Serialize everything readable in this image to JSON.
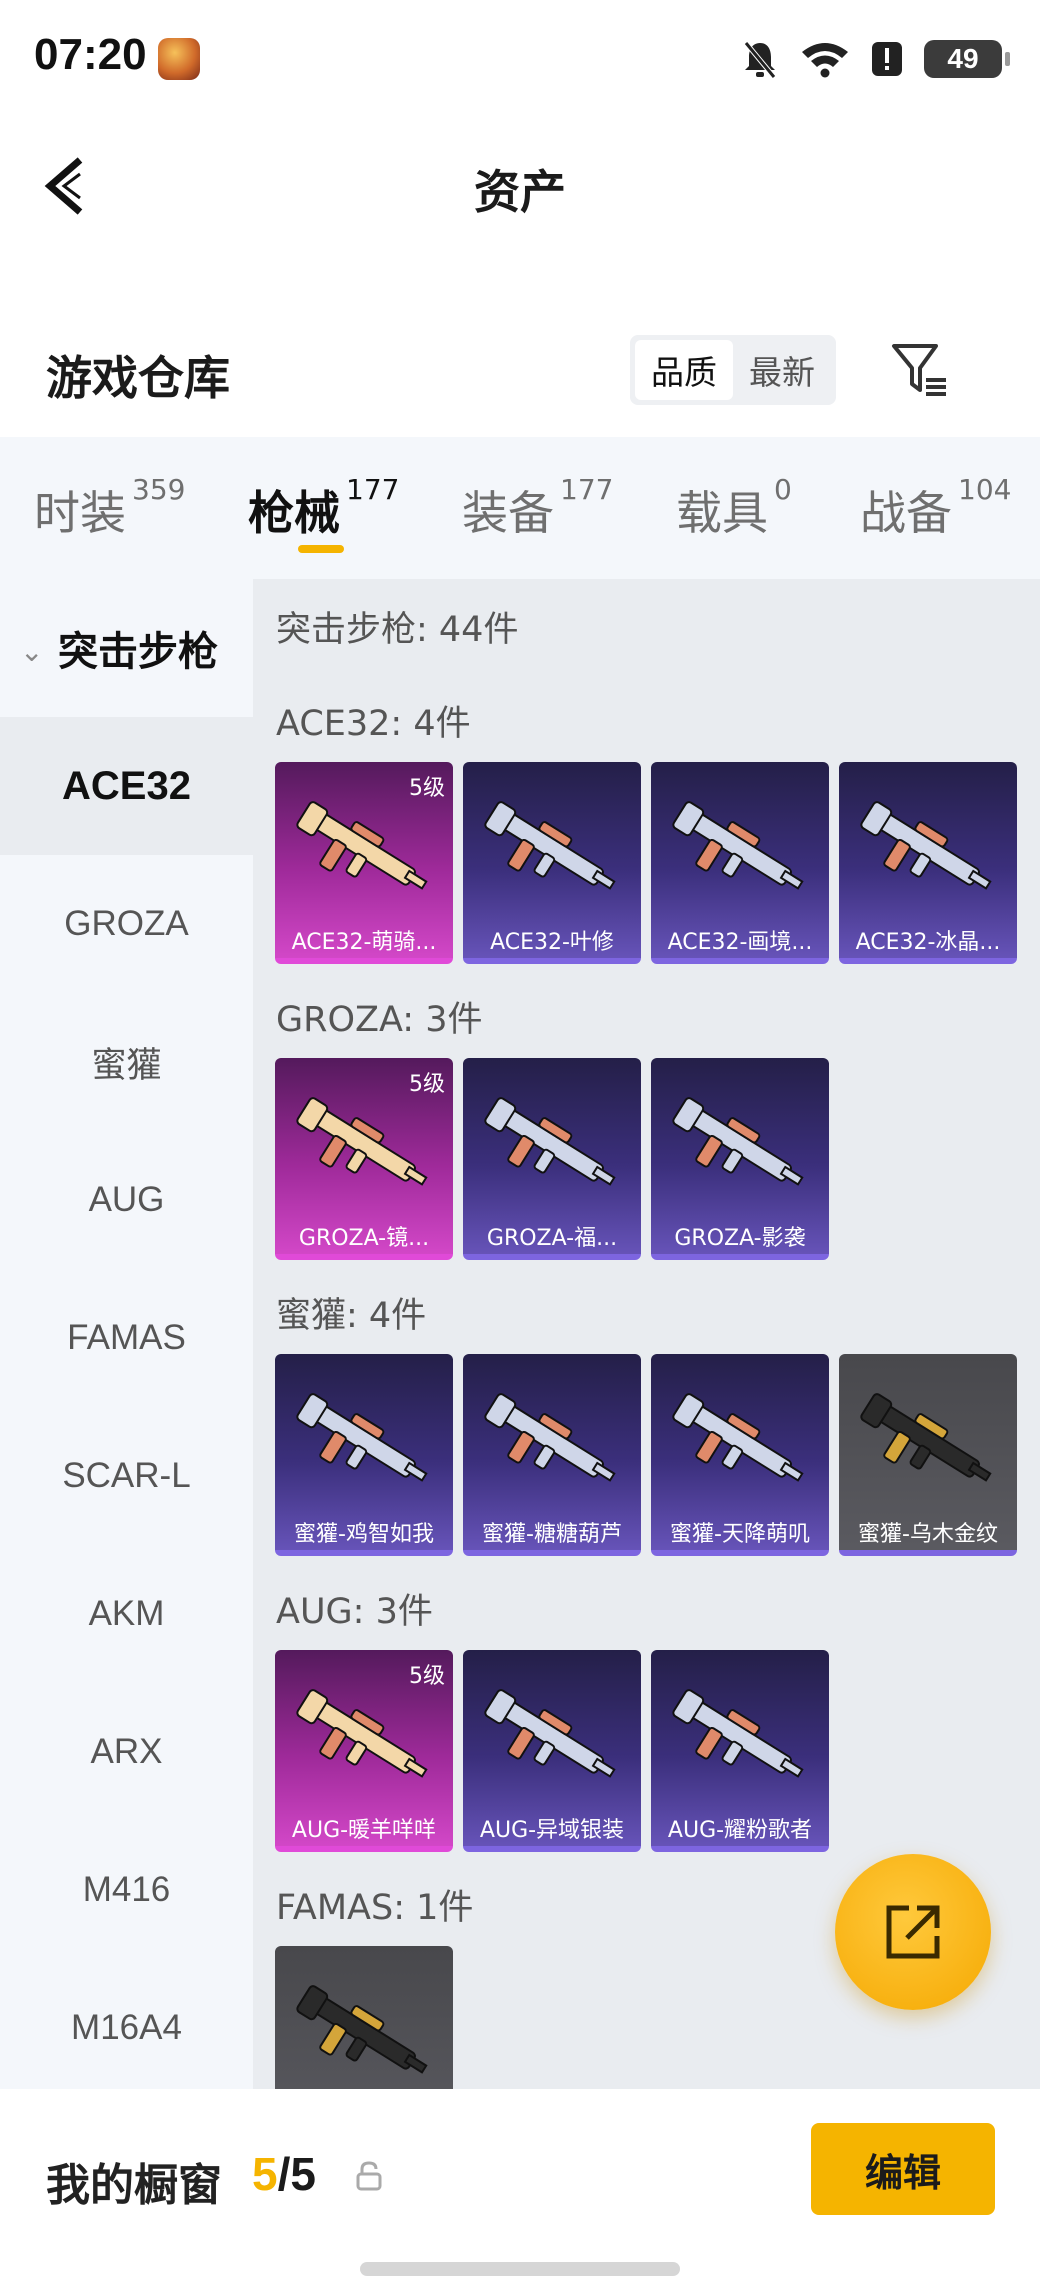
{
  "status_bar": {
    "time": "07:20",
    "battery": "49",
    "icons": [
      "bell-muted-icon",
      "wifi-icon",
      "alert-icon",
      "battery-icon"
    ]
  },
  "nav": {
    "title": "资产"
  },
  "warehouse": {
    "title": "游戏仓库",
    "sort_options": [
      "品质",
      "最新"
    ],
    "active_sort": "品质"
  },
  "tabs": [
    {
      "label": "时装",
      "count": "359"
    },
    {
      "label": "枪械",
      "count": "177"
    },
    {
      "label": "装备",
      "count": "177"
    },
    {
      "label": "载具",
      "count": "0"
    },
    {
      "label": "战备",
      "count": "104"
    }
  ],
  "active_tab": "枪械",
  "sidebar": {
    "category": "突击步枪",
    "items": [
      "ACE32",
      "GROZA",
      "蜜獾",
      "AUG",
      "FAMAS",
      "SCAR-L",
      "AKM",
      "ARX",
      "M416",
      "M16A4"
    ],
    "active": "ACE32"
  },
  "content": {
    "category_count": "突击步枪: 44件",
    "groups": [
      {
        "header": "ACE32: 4件",
        "items": [
          {
            "name": "ACE32-萌骑...",
            "level": "5级",
            "rarity": "pink"
          },
          {
            "name": "ACE32-叶修",
            "level": "",
            "rarity": "purple"
          },
          {
            "name": "ACE32-画境...",
            "level": "",
            "rarity": "purple"
          },
          {
            "name": "ACE32-冰晶...",
            "level": "",
            "rarity": "purple"
          }
        ]
      },
      {
        "header": "GROZA: 3件",
        "items": [
          {
            "name": "GROZA-镜...",
            "level": "5级",
            "rarity": "pink"
          },
          {
            "name": "GROZA-福...",
            "level": "",
            "rarity": "purple"
          },
          {
            "name": "GROZA-影袭",
            "level": "",
            "rarity": "purple"
          }
        ]
      },
      {
        "header": "蜜獾: 4件",
        "items": [
          {
            "name": "蜜獾-鸡智如我",
            "level": "",
            "rarity": "purple"
          },
          {
            "name": "蜜獾-糖糖葫芦",
            "level": "",
            "rarity": "purple"
          },
          {
            "name": "蜜獾-天降萌叽",
            "level": "",
            "rarity": "purple"
          },
          {
            "name": "蜜獾-乌木金纹",
            "level": "",
            "rarity": "gray"
          }
        ]
      },
      {
        "header": "AUG: 3件",
        "items": [
          {
            "name": "AUG-暖羊咩咩",
            "level": "5级",
            "rarity": "pink"
          },
          {
            "name": "AUG-异域银装",
            "level": "",
            "rarity": "purple"
          },
          {
            "name": "AUG-耀粉歌者",
            "level": "",
            "rarity": "purple"
          }
        ]
      },
      {
        "header": "FAMAS: 1件",
        "items": [
          {
            "name": "",
            "level": "",
            "rarity": "gray"
          }
        ]
      }
    ]
  },
  "showcase": {
    "title": "我的橱窗",
    "current": "5",
    "separator": "/",
    "total": "5",
    "edit_label": "编辑"
  },
  "colors": {
    "accent": "#f5b400",
    "pink_rarity": "#d247c7",
    "purple_rarity": "#6653b8"
  }
}
